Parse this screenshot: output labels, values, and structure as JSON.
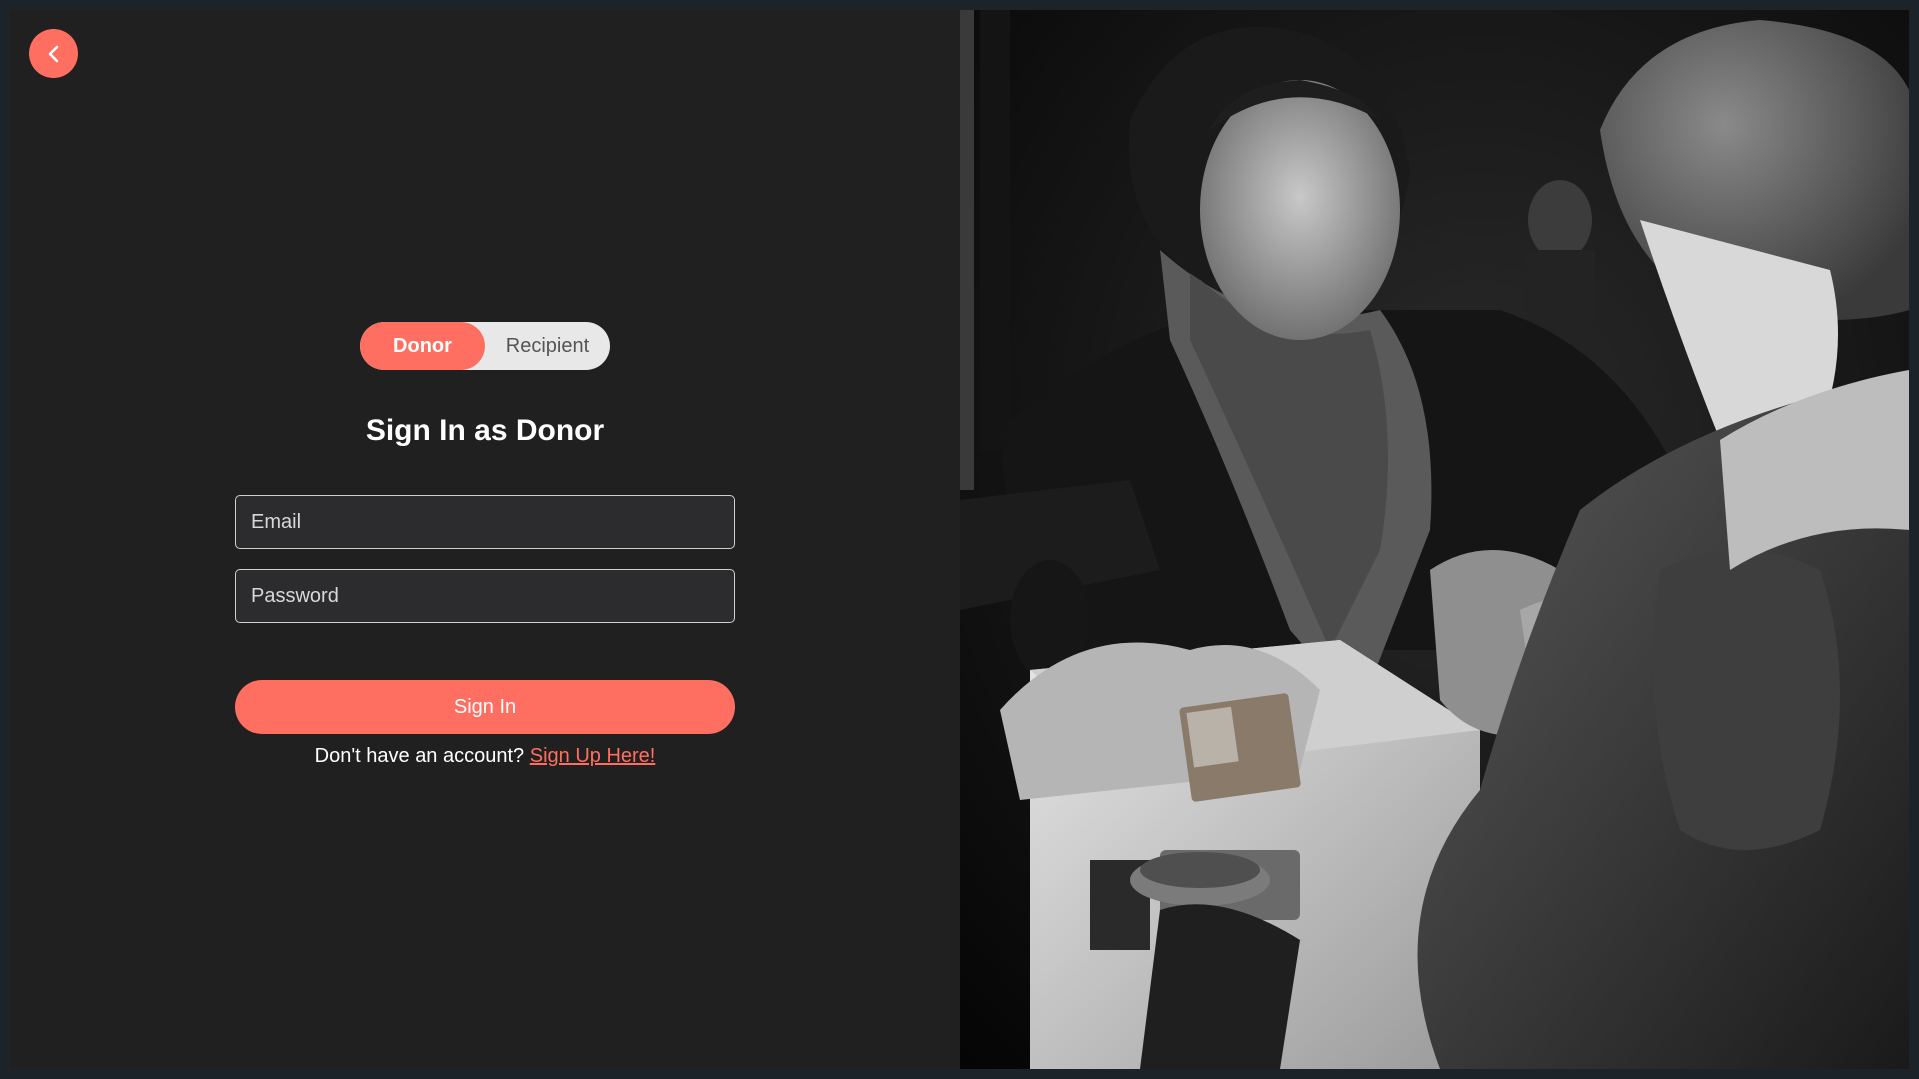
{
  "back_button": {
    "icon": "chevron-left-icon"
  },
  "role_toggle": {
    "options": [
      "Donor",
      "Recipient"
    ],
    "selected": "Donor"
  },
  "title": "Sign In as Donor",
  "email": {
    "placeholder": "Email",
    "value": ""
  },
  "password": {
    "placeholder": "Password",
    "value": ""
  },
  "signin_label": "Sign In",
  "signup": {
    "prompt": "Don't have an account?",
    "link_label": "Sign Up Here!"
  },
  "colors": {
    "accent": "#ff6f61",
    "background": "#202021",
    "toggle_bg": "#e8e8e8"
  }
}
